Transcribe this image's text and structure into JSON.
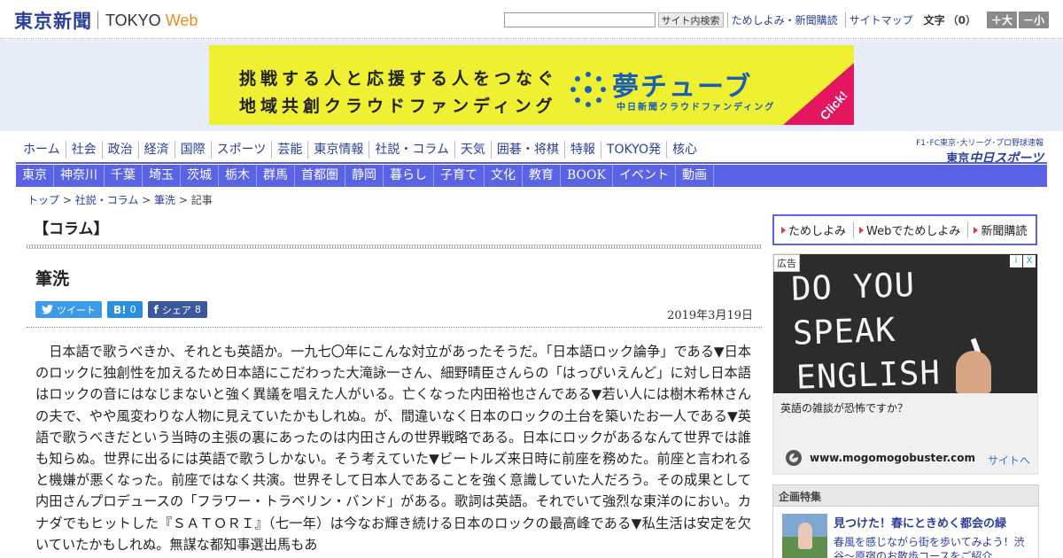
{
  "header": {
    "logo_main": "東京新聞",
    "logo_sub": "TOKYO",
    "logo_web": "Web",
    "search_button": "サイト内検索",
    "links": [
      "ためしよみ・新聞購読",
      "サイトマップ"
    ],
    "font_label": "文字",
    "font_count": "（0）",
    "font_plus": "＋大",
    "font_minus": "－小"
  },
  "banner": {
    "line1": "挑戦する人と応援する人をつなぐ",
    "line2": "地域共創クラウドファンディング",
    "brand": "夢チューブ",
    "brand_sub": "中日新聞クラウドファンディング",
    "click": "Click!"
  },
  "nav": {
    "primary": [
      "ホーム",
      "社会",
      "政治",
      "経済",
      "国際",
      "スポーツ",
      "芸能",
      "東京情報",
      "社説・コラム",
      "天気",
      "囲碁・将棋",
      "特報",
      "TOKYO発",
      "核心"
    ],
    "secondary": [
      "東京",
      "神奈川",
      "千葉",
      "埼玉",
      "茨城",
      "栃木",
      "群馬",
      "首都圏",
      "静岡",
      "暮らし",
      "子育て",
      "文化",
      "教育",
      "BOOK",
      "イベント",
      "動画"
    ],
    "partner_top": "F1･FC東京･大リーグ･プロ野球速報",
    "partner_logo_a": "東京",
    "partner_logo_b": "中日スポーツ"
  },
  "breadcrumb": {
    "items": [
      "トップ",
      "社説・コラム",
      "筆洗"
    ],
    "current": "記事",
    "sep": " > "
  },
  "article": {
    "section": "【コラム】",
    "title": "筆洗",
    "share": {
      "tweet": "ツイート",
      "hatena_icon": "B!",
      "hatena_count": "0",
      "fb_icon": "f",
      "fb_label": "シェア",
      "fb_count": "8"
    },
    "date": "2019年3月19日",
    "body": "日本語で歌うべきか、それとも英語か。一九七〇年にこんな対立があったそうだ。「日本語ロック論争」である▼日本のロックに独創性を加えるため日本語にこだわった大滝詠一さん、細野晴臣さんらの「はっぴいえんど」に対し日本語はロックの音にはなじまないと強く異議を唱えた人がいる。亡くなった内田裕也さんである▼若い人には樹木希林さんの夫で、やや風変わりな人物に見えていたかもしれぬ。が、間違いなく日本のロックの土台を築いたお一人である▼英語で歌うべきだという当時の主張の裏にあったのは内田さんの世界戦略である。日本にロックがあるなんて世界では誰も知らぬ。世界に出るには英語で歌うしかない。そう考えていた▼ビートルズ来日時に前座を務めた。前座と言われると機嫌が悪くなった。前座ではなく共演。世界そして日本人であることを強く意識していた人だろう。その成果として内田さんプロデュースの「フラワー・トラベリン・バンド」がある。歌詞は英語。それでいて強烈な東洋のにおい。カナダでもヒットした『ＳＡＴＯＲＩ』（七一年）は今なお輝き続ける日本のロックの最高峰である▼私生活は安定を欠いていたかもしれぬ。無謀な都知事選出馬もあ"
  },
  "sidebar": {
    "promo": [
      "ためしよみ",
      "Webでためしよみ",
      "新聞購読"
    ],
    "ad": {
      "badge": "広告",
      "board_line1": "DO YOU SPEAK",
      "board_line2": "ENGLISH ?",
      "caption": "英語の雑談が恐怖ですか？",
      "domain": "www.mogomogobuster.com",
      "cta": "サイトへ",
      "choice_i": "i",
      "choice_x": "X"
    },
    "feature": {
      "heading": "企画特集",
      "title": "見つけた！春にときめく都会の緑",
      "desc": "春風を感じながら街を歩いてみよう！渋谷～原宿のお散歩コースをご紹介"
    }
  },
  "colors": {
    "brand_blue": "#2a3f9b",
    "nav_bar": "#5a63e6",
    "banner_yellow": "#eef031",
    "banner_bg": "#e6edf8",
    "click_pink": "#e3165f",
    "arrow_red": "#e33a3a"
  },
  "icons": {
    "twitter": "twitter-icon",
    "hatena": "hatena-bookmark-icon",
    "facebook": "facebook-icon",
    "globe": "globe-icon",
    "arrow": "triangle-right-icon",
    "dots": "dream-tube-dots-icon"
  }
}
